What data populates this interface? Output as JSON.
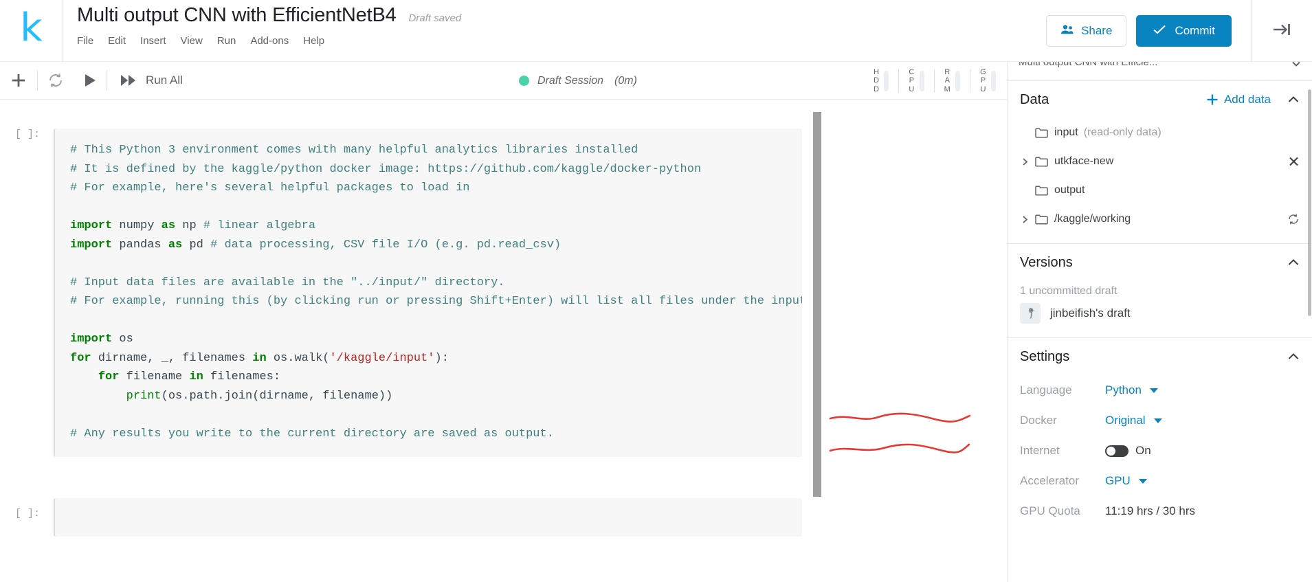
{
  "header": {
    "logo": "kaggle-logo-k",
    "notebook_title": "Multi output CNN with EfficientNetB4",
    "save_status": "Draft saved",
    "menu": [
      {
        "label": "File"
      },
      {
        "label": "Edit"
      },
      {
        "label": "Insert"
      },
      {
        "label": "View"
      },
      {
        "label": "Run"
      },
      {
        "label": "Add-ons"
      },
      {
        "label": "Help"
      }
    ],
    "share_label": "Share",
    "commit_label": "Commit",
    "accent_blue": "#0a84c1",
    "logo_color": "#20BEFF"
  },
  "toolbar": {
    "add_cell": "+",
    "run_all_label": "Run All",
    "session_status": "Draft Session",
    "session_time": "(0m)",
    "session_dot_color": "#4ad3a6",
    "meters": [
      {
        "name": "HDD",
        "letters": [
          "H",
          "D",
          "D"
        ]
      },
      {
        "name": "CPU",
        "letters": [
          "C",
          "P",
          "U"
        ]
      },
      {
        "name": "RAM",
        "letters": [
          "R",
          "A",
          "M"
        ]
      },
      {
        "name": "GPU",
        "letters": [
          "G",
          "P",
          "U"
        ]
      }
    ]
  },
  "notebook": {
    "cells": [
      {
        "prompt": "[ ]:",
        "lines": [
          [
            {
              "t": "# This Python 3 environment comes with many helpful analytics libraries installed",
              "c": "cm"
            }
          ],
          [
            {
              "t": "# It is defined by the kaggle/python docker image: https://github.com/kaggle/docker-python",
              "c": "cm"
            }
          ],
          [
            {
              "t": "# For example, here's several helpful packages to load in",
              "c": "cm"
            }
          ],
          [
            {
              "t": "",
              "c": "pl"
            }
          ],
          [
            {
              "t": "import",
              "c": "k"
            },
            {
              "t": " numpy ",
              "c": "pl"
            },
            {
              "t": "as",
              "c": "k"
            },
            {
              "t": " np ",
              "c": "pl"
            },
            {
              "t": "# linear algebra",
              "c": "cm"
            }
          ],
          [
            {
              "t": "import",
              "c": "k"
            },
            {
              "t": " pandas ",
              "c": "pl"
            },
            {
              "t": "as",
              "c": "k"
            },
            {
              "t": " pd ",
              "c": "pl"
            },
            {
              "t": "# data processing, CSV file I/O (e.g. pd.read_csv)",
              "c": "cm"
            }
          ],
          [
            {
              "t": "",
              "c": "pl"
            }
          ],
          [
            {
              "t": "# Input data files are available in the \"../input/\" directory.",
              "c": "cm"
            }
          ],
          [
            {
              "t": "# For example, running this (by clicking run or pressing Shift+Enter) will list all files under the input directo",
              "c": "cm"
            }
          ],
          [
            {
              "t": "",
              "c": "pl"
            }
          ],
          [
            {
              "t": "import",
              "c": "k"
            },
            {
              "t": " os",
              "c": "pl"
            }
          ],
          [
            {
              "t": "for",
              "c": "k"
            },
            {
              "t": " dirname, _, filenames ",
              "c": "pl"
            },
            {
              "t": "in",
              "c": "k"
            },
            {
              "t": " os.walk(",
              "c": "pl"
            },
            {
              "t": "'/kaggle/input'",
              "c": "st"
            },
            {
              "t": "):",
              "c": "pl"
            }
          ],
          [
            {
              "t": "    ",
              "c": "pl"
            },
            {
              "t": "for",
              "c": "k"
            },
            {
              "t": " filename ",
              "c": "pl"
            },
            {
              "t": "in",
              "c": "k"
            },
            {
              "t": " filenames:",
              "c": "pl"
            }
          ],
          [
            {
              "t": "        ",
              "c": "pl"
            },
            {
              "t": "print",
              "c": "bi"
            },
            {
              "t": "(os.path.join(dirname, filename))",
              "c": "pl"
            }
          ],
          [
            {
              "t": "",
              "c": "pl"
            }
          ],
          [
            {
              "t": "# Any results you write to the current directory are saved as output.",
              "c": "cm"
            }
          ]
        ]
      },
      {
        "prompt": "[ ]:",
        "lines": []
      }
    ]
  },
  "sidebar": {
    "clipped_title": "Multi output CNN with Efficie...",
    "data": {
      "title": "Data",
      "add_label": "Add data",
      "collapse_icon": "chevron-up-icon",
      "items": [
        {
          "label": "input",
          "suffix": "(read-only data)",
          "expandable": false,
          "right_icon": "none"
        },
        {
          "label": "utkface-new",
          "suffix": "",
          "expandable": true,
          "right_icon": "close-icon"
        },
        {
          "label": "output",
          "suffix": "",
          "expandable": false,
          "right_icon": "none"
        },
        {
          "label": "/kaggle/working",
          "suffix": "",
          "expandable": true,
          "right_icon": "refresh-icon"
        }
      ]
    },
    "versions": {
      "title": "Versions",
      "collapse_icon": "chevron-up-icon",
      "subtitle": "1 uncommitted draft",
      "draft_name": "jinbeifish's draft"
    },
    "settings": {
      "title": "Settings",
      "collapse_icon": "chevron-up-icon",
      "rows": [
        {
          "label": "Language",
          "value": "Python",
          "type": "dropdown"
        },
        {
          "label": "Docker",
          "value": "Original",
          "type": "dropdown"
        },
        {
          "label": "Internet",
          "value": "On",
          "type": "toggle"
        },
        {
          "label": "Accelerator",
          "value": "GPU",
          "type": "dropdown"
        },
        {
          "label": "GPU Quota",
          "value": "11:19 hrs / 30 hrs",
          "type": "text"
        }
      ]
    }
  },
  "annotations": {
    "color": "#e53935",
    "marks": [
      "underline-internet",
      "underline-accelerator"
    ]
  }
}
